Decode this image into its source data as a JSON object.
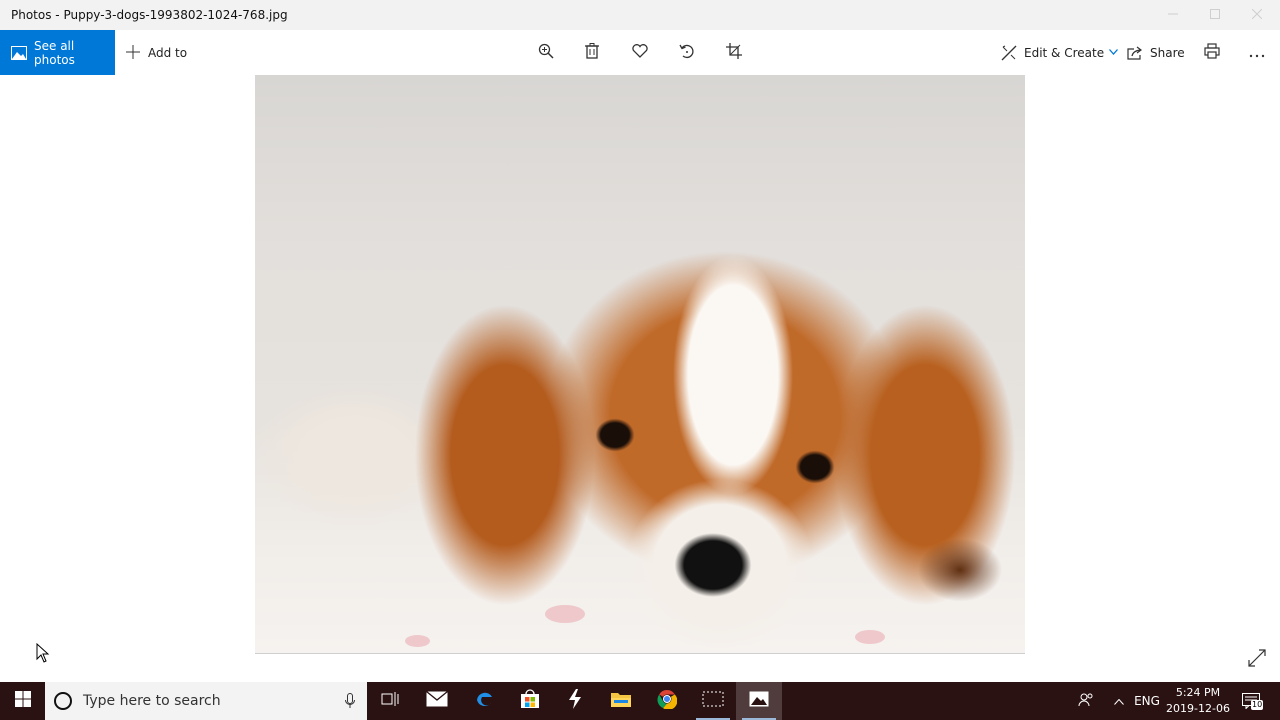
{
  "window": {
    "title": "Photos - Puppy-3-dogs-1993802-1024-768.jpg",
    "controls": [
      "minimize-icon",
      "maximize-icon",
      "close-icon"
    ]
  },
  "toolbar": {
    "see_all_label": "See all photos",
    "add_to_label": "Add to",
    "center_icons": [
      "zoom-icon",
      "delete-icon",
      "favorite-icon",
      "rotate-icon",
      "crop-icon"
    ],
    "edit_create_label": "Edit & Create",
    "share_label": "Share",
    "more_label": "···",
    "accent_color": "#0078d7"
  },
  "photo": {
    "subject": "puppy"
  },
  "taskbar": {
    "search_placeholder": "Type here to search",
    "apps": [
      "task-view-icon",
      "mail-icon",
      "edge-icon",
      "store-icon",
      "app-icon",
      "file-explorer-icon",
      "chrome-icon",
      "snipping-tool-icon",
      "photos-icon"
    ],
    "language": "ENG",
    "time": "5:24 PM",
    "date": "2019-12-06",
    "notifications_count": "10",
    "background_color": "#2a1212"
  }
}
